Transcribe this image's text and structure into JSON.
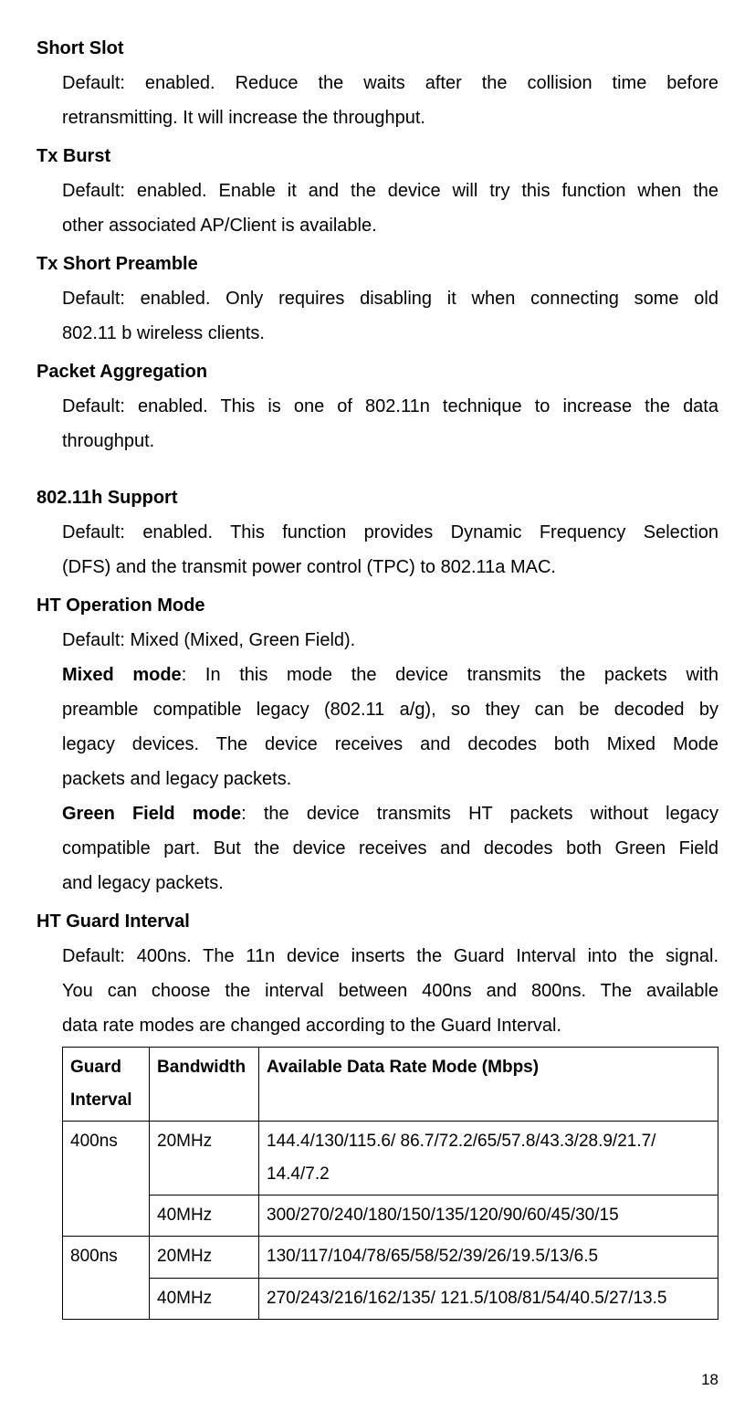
{
  "sections": {
    "shortSlot": {
      "title": "Short Slot",
      "desc1": "Default: enabled. Reduce the waits after the collision time before",
      "desc2": "retransmitting. It will increase the throughput."
    },
    "txBurst": {
      "title": "Tx Burst",
      "desc1": "Default: enabled. Enable it and the device will try this function when the",
      "desc2": "other associated AP/Client is available."
    },
    "txShortPreamble": {
      "title": "Tx Short Preamble",
      "desc1": "Default: enabled. Only requires disabling it when connecting some old",
      "desc2": "802.11 b wireless clients."
    },
    "packetAggregation": {
      "title": "Packet Aggregation",
      "desc1": "Default: enabled. This is one of 802.11n technique to increase the data",
      "desc2": "throughput."
    },
    "support80211h": {
      "title": "802.11h Support",
      "desc1": "Default: enabled. This function provides Dynamic Frequency Selection",
      "desc2": "(DFS) and the transmit power control (TPC) to 802.11a MAC."
    },
    "htOperationMode": {
      "title": "HT Operation Mode",
      "default": "Default: Mixed (Mixed, Green Field).",
      "mixedLabel": "Mixed mode",
      "mixedText1": ": In this mode the device transmits the packets with",
      "mixedText2": "preamble compatible legacy (802.11 a/g), so they can be decoded by",
      "mixedText3": "legacy devices. The device receives and decodes both Mixed Mode",
      "mixedText4": "packets and legacy packets.",
      "greenLabel": "Green Field mode",
      "greenText1": ": the device transmits HT packets without legacy",
      "greenText2": "compatible part. But the device receives and decodes both Green Field",
      "greenText3": "and legacy packets."
    },
    "htGuardInterval": {
      "title": "HT Guard Interval",
      "desc1": "Default: 400ns. The 11n device inserts the Guard Interval into the signal.",
      "desc2": "You can choose the interval between 400ns and 800ns. The available",
      "desc3": "data rate modes are changed according to the Guard Interval."
    }
  },
  "table": {
    "headers": {
      "col1": "Guard Interval",
      "col2": "Bandwidth",
      "col3": "Available Data Rate Mode (Mbps)"
    },
    "rows": [
      {
        "guard": "400ns",
        "bandwidth": "20MHz",
        "rate": "144.4/130/115.6/ 86.7/72.2/65/57.8/43.3/28.9/21.7/ 14.4/7.2"
      },
      {
        "guard": "",
        "bandwidth": "40MHz",
        "rate": "300/270/240/180/150/135/120/90/60/45/30/15"
      },
      {
        "guard": "800ns",
        "bandwidth": "20MHz",
        "rate": "130/117/104/78/65/58/52/39/26/19.5/13/6.5"
      },
      {
        "guard": "",
        "bandwidth": "40MHz",
        "rate": "270/243/216/162/135/ 121.5/108/81/54/40.5/27/13.5"
      }
    ]
  },
  "pageNumber": "18"
}
